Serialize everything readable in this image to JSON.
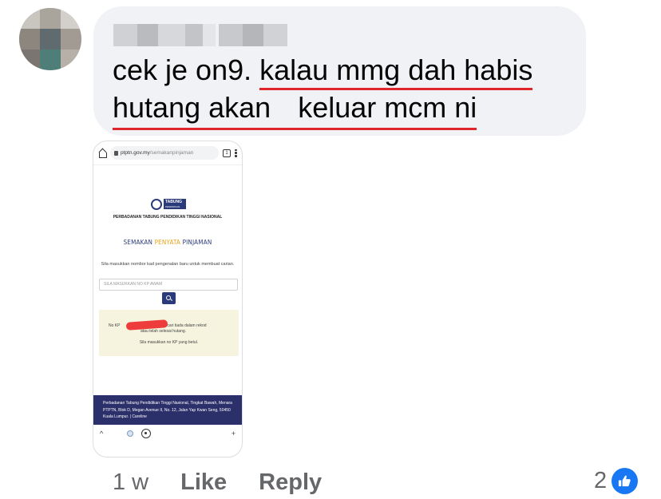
{
  "comment": {
    "text_line1_plain": "cek je on9.",
    "text_line1_marked": "kalau mmg dah habis",
    "text_line2_part1": "hutang akan",
    "text_line2_part2": "keluar mcm ni"
  },
  "screenshot": {
    "url_domain": "ptptn.gov.my",
    "url_path": "/semakanpinjaman",
    "tab_count": "1",
    "logo_text": "TABUNG",
    "logo_subtext": "PENDIDIKAN",
    "org_name": "PERBADANAN TABUNG PENDIDIKAN TINGGI NASIONAL",
    "heading_w1": "SEMAKAN",
    "heading_w2": "PENYATA",
    "heading_w3": "PINJAMAN",
    "instruction": "Sila masukkan nombor kad pengenalan baru untuk membuat carian.",
    "input_placeholder": "SILA MASUKKAN NO KP AWAM",
    "alert_prefix": "No KP",
    "alert_mid": "ang dicari tiada dalam rekod",
    "alert_end": "atau telah selesai hutang.",
    "alert_hint": "Sila masukkan no KP yang betul.",
    "footer_text": "Perbadanan Tabung Pendidikan Tinggi Nasional, Tingkat Bawah, Menara PTPTN, Blok D, Megan Avenue II, No. 12, Jalan Yap Kwan Seng, 50450 Kuala Lumpur. | Careline",
    "bottom_left": "^",
    "bottom_right": "+"
  },
  "actions": {
    "time": "1 w",
    "like": "Like",
    "reply": "Reply",
    "reaction_count": "2"
  },
  "colors": {
    "bubble": "#f0f2f5",
    "underline": "#e0242b",
    "like_blue": "#1877f2",
    "ptptn_navy": "#2b3a7a",
    "ptptn_gold": "#e8a21c"
  },
  "icons": [
    "home-icon",
    "lock-icon",
    "tabs-icon",
    "menu-icon",
    "search-icon",
    "camera-icon",
    "thumbs-up-icon"
  ]
}
